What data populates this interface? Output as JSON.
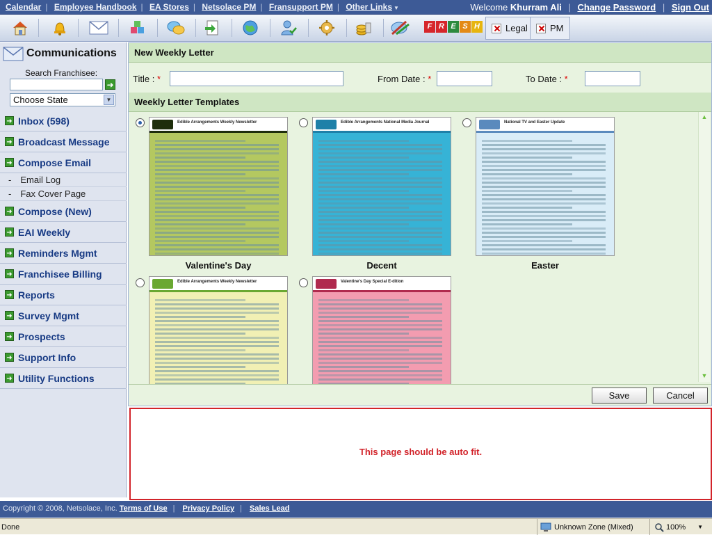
{
  "topbar": {
    "links": [
      "Calendar",
      "Employee Handbook",
      "EA Stores",
      "Netsolace PM",
      "Fransupport PM",
      "Other Links"
    ],
    "welcome": "Welcome",
    "username": "Khurram Ali",
    "change_password": "Change Password",
    "sign_out": "Sign Out"
  },
  "toolbar": {
    "icons": [
      "home-icon",
      "bell-icon",
      "mail-icon",
      "blocks-icon",
      "chat-icon",
      "export-icon",
      "globe-icon",
      "user-check-icon",
      "settings-icon",
      "coins-icon",
      "tools-icon"
    ],
    "fresh_letters": [
      "F",
      "R",
      "E",
      "S",
      "H"
    ],
    "fresh_colors": [
      "#d6262b",
      "#d6262b",
      "#2d8a3f",
      "#e38a16",
      "#e7b50e"
    ],
    "tabs": [
      "Legal",
      "PM"
    ]
  },
  "sidebar": {
    "title": "Communications",
    "search_label": "Search Franchisee:",
    "state_select": "Choose State",
    "items": [
      {
        "label": "Inbox (598)"
      },
      {
        "label": "Broadcast Message"
      },
      {
        "label": "Compose Email"
      },
      {
        "label": "Compose (New)"
      },
      {
        "label": "EAI Weekly"
      },
      {
        "label": "Reminders Mgmt"
      },
      {
        "label": "Franchisee Billing"
      },
      {
        "label": "Reports"
      },
      {
        "label": "Survey Mgmt"
      },
      {
        "label": "Prospects"
      },
      {
        "label": "Support Info"
      },
      {
        "label": "Utility Functions"
      }
    ],
    "subitems": [
      "Email Log",
      "Fax Cover Page"
    ]
  },
  "main": {
    "header": "New Weekly Letter",
    "title_label": "Title :",
    "from_label": "From Date :",
    "to_label": "To Date :",
    "required_mark": "*",
    "templates_header": "Weekly Letter Templates",
    "templates": [
      {
        "caption": "Valentine's Day",
        "selected": true,
        "bg": "#b4c860",
        "band": "#1e2e0c",
        "label": "Edible Arrangements Weekly Newsletter"
      },
      {
        "caption": "Decent",
        "selected": false,
        "bg": "#36b3d6",
        "band": "#1e80a8",
        "label": "Edible Arrangements National Media Journal"
      },
      {
        "caption": "Easter",
        "selected": false,
        "bg": "#d9ecf7",
        "band": "#5a8abd",
        "label": "National TV and Easter Update"
      },
      {
        "caption": "",
        "selected": false,
        "bg": "#f1f0b4",
        "band": "#6aa832",
        "label": "Edible Arrangements Weekly Newsletter"
      },
      {
        "caption": "",
        "selected": false,
        "bg": "#f39cb0",
        "band": "#b02a4e",
        "label": "Valentine's Day Special E-dition"
      }
    ],
    "save": "Save",
    "cancel": "Cancel"
  },
  "autofit_message": "This page should be auto fit.",
  "footer": {
    "copyright": "Copyright © 2008, Netsolace, Inc.",
    "links": [
      "Terms of Use",
      "Privacy Policy",
      "Sales Lead"
    ]
  },
  "statusbar": {
    "status": "Done",
    "zone": "Unknown Zone (Mixed)",
    "zoom": "100%"
  }
}
